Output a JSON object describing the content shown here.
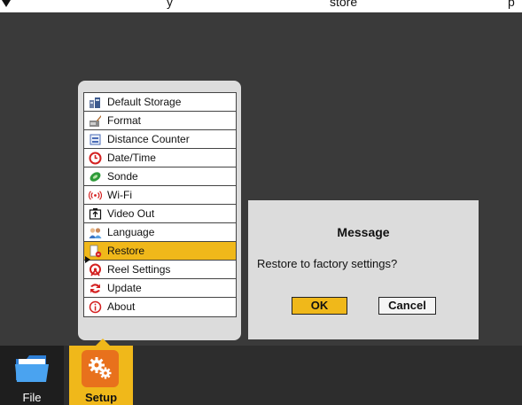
{
  "topbar": {
    "text_left": "y",
    "text_mid": "store",
    "text_right": "p"
  },
  "menu": {
    "items": [
      {
        "label": "Default Storage",
        "icon": "storage-icon"
      },
      {
        "label": "Format",
        "icon": "format-icon"
      },
      {
        "label": "Distance Counter",
        "icon": "distance-counter-icon"
      },
      {
        "label": "Date/Time",
        "icon": "clock-icon"
      },
      {
        "label": "Sonde",
        "icon": "sonde-icon"
      },
      {
        "label": "Wi-Fi",
        "icon": "wifi-icon"
      },
      {
        "label": "Video Out",
        "icon": "video-out-icon"
      },
      {
        "label": "Language",
        "icon": "language-icon"
      },
      {
        "label": "Restore",
        "icon": "restore-icon",
        "selected": true
      },
      {
        "label": "Reel Settings",
        "icon": "reel-icon"
      },
      {
        "label": "Update",
        "icon": "update-icon"
      },
      {
        "label": "About",
        "icon": "info-icon"
      }
    ]
  },
  "dialog": {
    "title": "Message",
    "message": "Restore to factory settings?",
    "ok_label": "OK",
    "cancel_label": "Cancel"
  },
  "dock": {
    "file_label": "File",
    "setup_label": "Setup"
  },
  "colors": {
    "accent": "#f0b81a",
    "setup_icon_bg": "#e8711c",
    "background": "#3a3a3a",
    "panel": "#dcdcdc"
  }
}
